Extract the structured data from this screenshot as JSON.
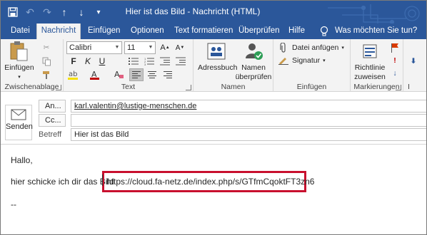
{
  "window": {
    "title": "Hier ist das Bild  -  Nachricht (HTML)",
    "brand_color": "#2b579a",
    "qat_icons": [
      "save-icon",
      "undo-icon",
      "redo-icon",
      "up-arrow-icon",
      "down-arrow-icon",
      "customize-icon"
    ]
  },
  "tabs": [
    {
      "label": "Datei"
    },
    {
      "label": "Nachricht",
      "active": true
    },
    {
      "label": "Einfügen"
    },
    {
      "label": "Optionen"
    },
    {
      "label": "Text formatieren"
    },
    {
      "label": "Überprüfen"
    },
    {
      "label": "Hilfe"
    }
  ],
  "tell_me": "Was möchten Sie tun?",
  "ribbon": {
    "clipboard": {
      "group_label": "Zwischenablage",
      "paste_label": "Einfügen"
    },
    "text": {
      "group_label": "Text",
      "font": "Calibri",
      "size": "11",
      "bold": "F",
      "italic": "K",
      "underline": "U"
    },
    "names": {
      "group_label": "Namen",
      "addressbook_label": "Adressbuch",
      "checknames_label_1": "Namen",
      "checknames_label_2": "überprüfen"
    },
    "include": {
      "group_label": "Einfügen",
      "attach_label": "Datei anfügen",
      "signature_label": "Signatur"
    },
    "tags": {
      "group_label": "Markierungen",
      "policy_label_1": "Richtlinie",
      "policy_label_2": "zuweisen"
    },
    "overflow_label": "I"
  },
  "header": {
    "send_label": "Senden",
    "to_button": "An...",
    "cc_button": "Cc...",
    "subject_label": "Betreff",
    "to_value": "karl.valentin@lustige-menschen.de",
    "cc_value": "",
    "subject_value": "Hier ist das Bild"
  },
  "body": {
    "greeting": "Hallo,",
    "sentence": "hier schicke ich dir das Bild",
    "link": "https://cloud.fa-netz.de/index.php/s/GTfmCqoktFT3zn6",
    "signature": "--",
    "highlight_color": "#c8102e"
  }
}
